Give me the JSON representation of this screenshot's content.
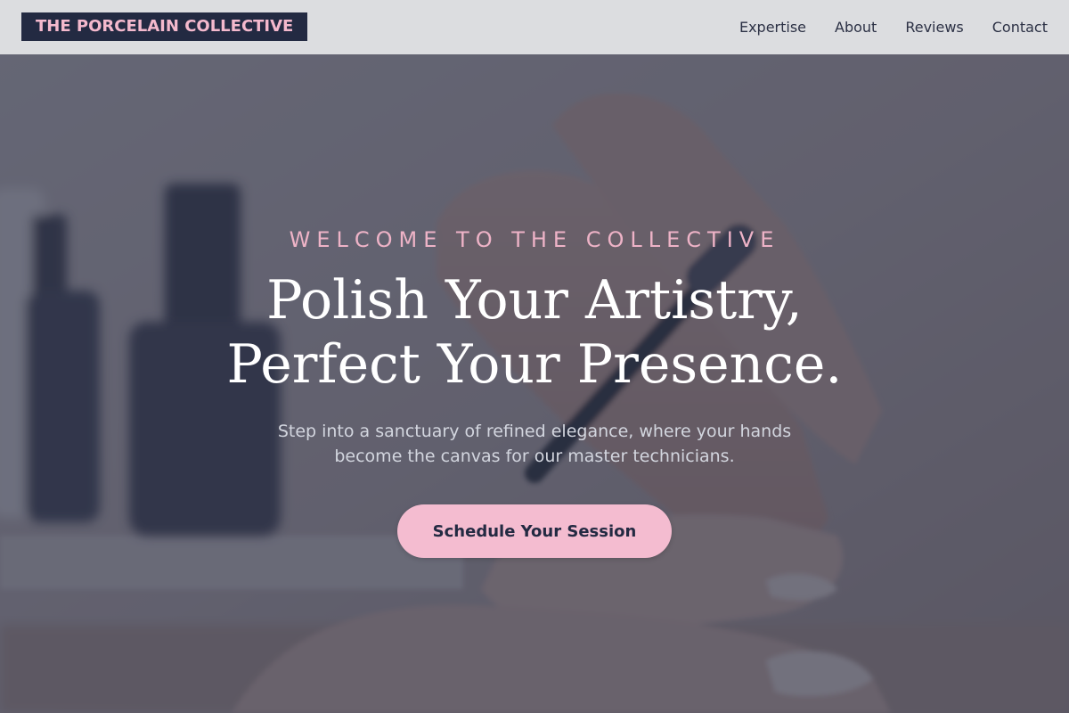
{
  "header": {
    "brand": "THE PORCELAIN COLLECTIVE",
    "nav": [
      {
        "label": "Expertise"
      },
      {
        "label": "About"
      },
      {
        "label": "Reviews"
      },
      {
        "label": "Contact"
      }
    ]
  },
  "hero": {
    "eyebrow": "WELCOME TO THE COLLECTIVE",
    "headline_line1": "Polish Your Artistry,",
    "headline_line2": "Perfect Your Presence.",
    "subtext": "Step into a sanctuary of refined elegance, where your hands become the canvas for our master technicians.",
    "cta_label": "Schedule Your Session",
    "background_image": "manicure-photo"
  },
  "colors": {
    "brand_bg": "#232a42",
    "brand_text": "#f4b9cd",
    "header_bg": "#dcdde0",
    "accent_pink": "#f4bcd0",
    "overlay": "#303448"
  }
}
